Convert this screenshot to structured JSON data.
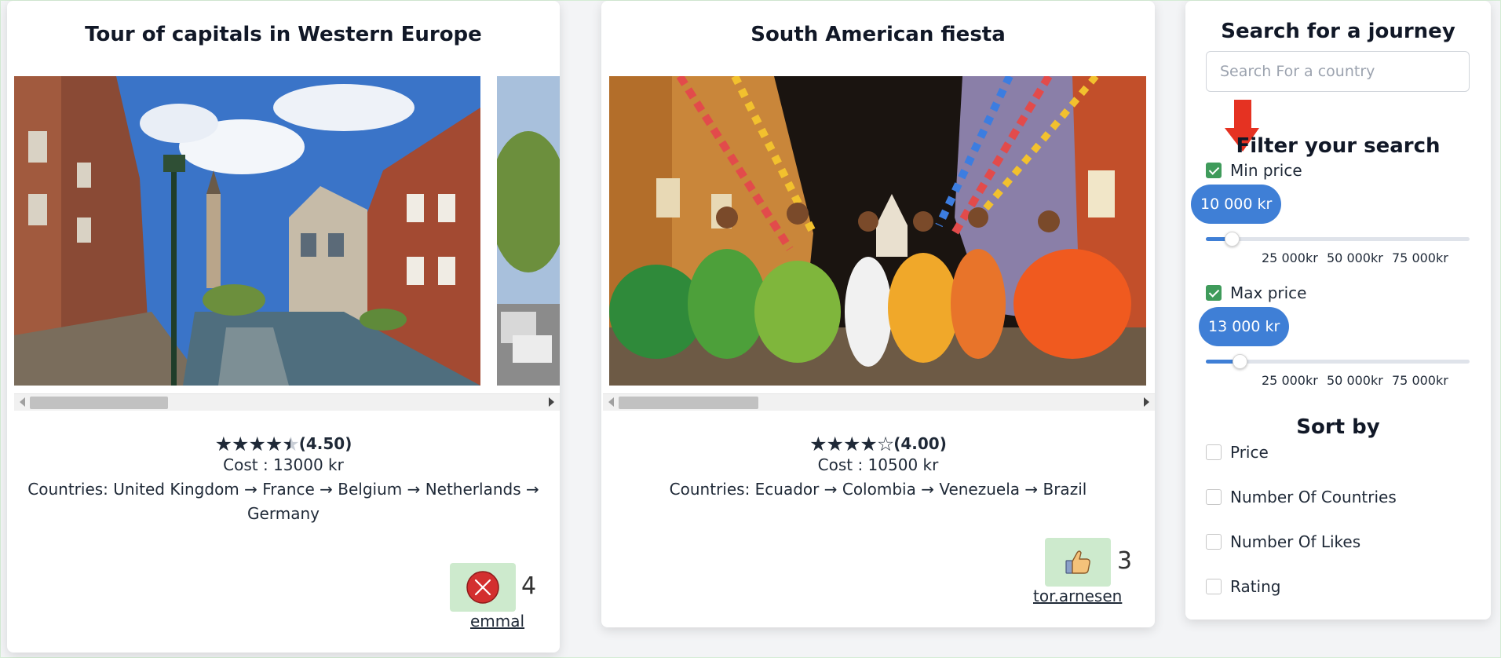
{
  "cards": [
    {
      "title": "Tour of capitals in Western Europe",
      "rating_text": "(4.50)",
      "rating": 4.5,
      "stars": [
        "full",
        "full",
        "full",
        "full",
        "half"
      ],
      "cost": "Cost : 13000 kr",
      "countries_line1": "Countries: United Kingdom → France → Belgium → Netherlands →",
      "countries_line2": "Germany",
      "like_state": "remove",
      "like_icon": "close-circle-icon",
      "like_count": "4",
      "user": "emmal",
      "photo_subject": "canal-street-photo"
    },
    {
      "title": "South American fiesta",
      "rating_text": "(4.00)",
      "rating": 4.0,
      "stars": [
        "full",
        "full",
        "full",
        "full",
        "empty"
      ],
      "cost": "Cost : 10500 kr",
      "countries_line1": "Countries: Ecuador → Colombia → Venezuela → Brazil",
      "like_state": "like",
      "like_icon": "thumbs-up-icon",
      "like_count": "3",
      "user": "tor.arnesen",
      "photo_subject": "carnival-dancers-photo"
    }
  ],
  "sidebar": {
    "title": "Search for a journey",
    "search_placeholder": "Search For a country",
    "filter_title": "Filter your search",
    "min_price": {
      "label": "Min price",
      "checked": true,
      "value_label": "10 000 kr",
      "fraction": 0.1,
      "ticks": [
        "25 000kr",
        "50 000kr",
        "75 000kr"
      ]
    },
    "max_price": {
      "label": "Max price",
      "checked": true,
      "value_label": "13 000 kr",
      "fraction": 0.13,
      "ticks": [
        "25 000kr",
        "50 000kr",
        "75 000kr"
      ]
    },
    "sort_title": "Sort by",
    "sort_options": [
      "Price",
      "Number Of Countries",
      "Number Of Likes",
      "Rating"
    ]
  },
  "colors": {
    "accent_blue": "#3f7fd6",
    "check_green": "#3f9b5b",
    "like_bg": "#cdeacd",
    "annotation_arrow": "#e53222",
    "remove_red": "#d32f2f"
  }
}
